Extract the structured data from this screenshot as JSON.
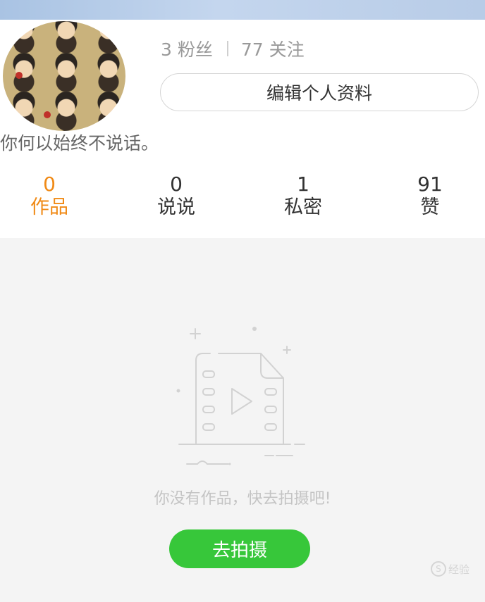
{
  "profile": {
    "fans_count": "3",
    "fans_label": "粉丝",
    "following_count": "77",
    "following_label": "关注",
    "edit_label": "编辑个人资料",
    "bio": "你何以始终不说话。"
  },
  "tabs": [
    {
      "count": "0",
      "label": "作品",
      "active": true
    },
    {
      "count": "0",
      "label": "说说",
      "active": false
    },
    {
      "count": "1",
      "label": "私密",
      "active": false
    },
    {
      "count": "91",
      "label": "赞",
      "active": false
    }
  ],
  "empty": {
    "icon": "video-file-icon",
    "message": "你没有作品，快去拍摄吧!",
    "action_label": "去拍摄"
  },
  "watermark": {
    "text": "经验",
    "mark": "S"
  },
  "colors": {
    "accent_orange": "#f08a16",
    "button_green": "#37c73a",
    "header_blue": "#b8cce7"
  }
}
